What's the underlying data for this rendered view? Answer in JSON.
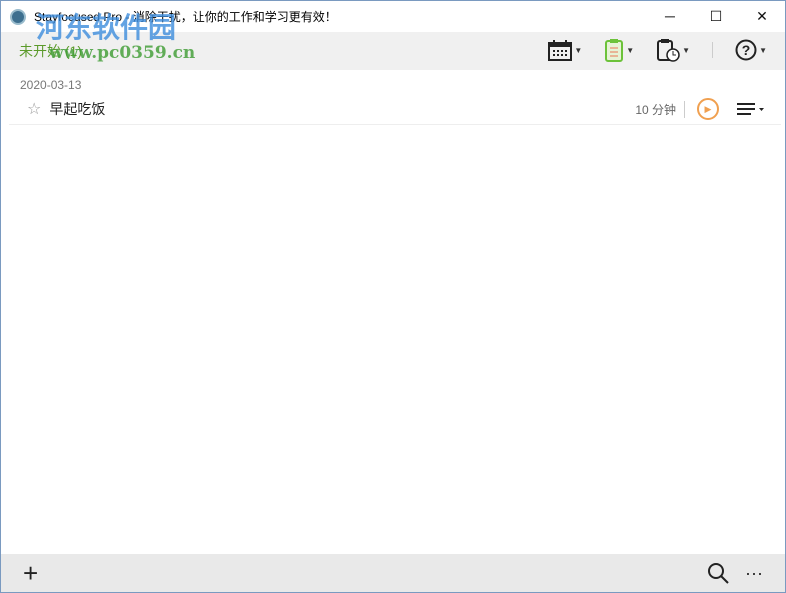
{
  "window": {
    "title": "Stayfocused Pro - 消除干扰，让你的工作和学习更有效！",
    "minimize": "─",
    "maximize": "☐",
    "close": "✕"
  },
  "toolbar": {
    "tab_label": "未开始 (1)"
  },
  "list": {
    "date": "2020-03-13",
    "tasks": [
      {
        "name": "早起吃饭",
        "duration": "10 分钟"
      }
    ]
  },
  "watermark": {
    "line1": "河东软件园",
    "line2": "www.pc0359.cn"
  },
  "bottom": {
    "add": "+",
    "more": "···"
  },
  "colors": {
    "accent_green": "#5b9a2a",
    "play_orange": "#f0a050"
  }
}
